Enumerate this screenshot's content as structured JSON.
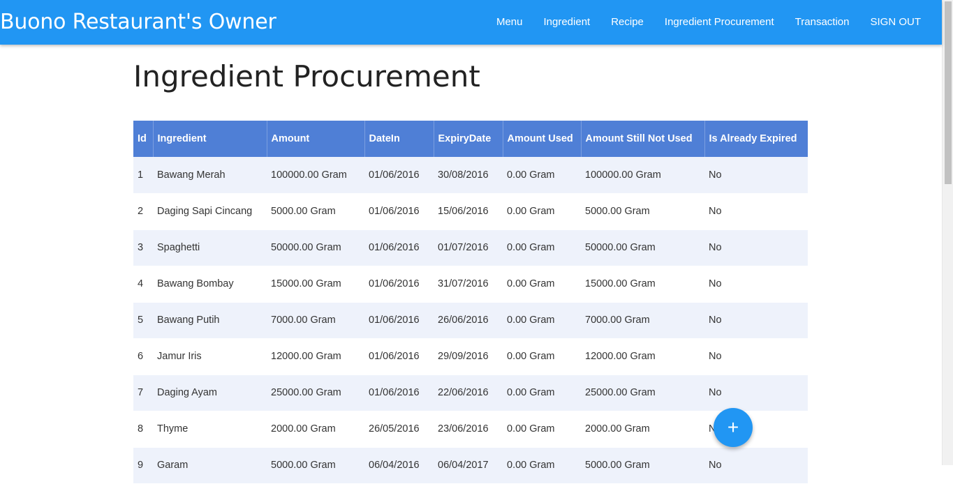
{
  "navbar": {
    "brand": "Buono Restaurant's Owner",
    "links": [
      "Menu",
      "Ingredient",
      "Recipe",
      "Ingredient Procurement",
      "Transaction",
      "SIGN OUT"
    ]
  },
  "page": {
    "title": "Ingredient Procurement"
  },
  "table": {
    "columns": [
      "Id",
      "Ingredient",
      "Amount",
      "DateIn",
      "ExpiryDate",
      "Amount Used",
      "Amount Still Not Used",
      "Is Already Expired"
    ],
    "rows": [
      [
        "1",
        "Bawang Merah",
        "100000.00 Gram",
        "01/06/2016",
        "30/08/2016",
        "0.00 Gram",
        "100000.00 Gram",
        "No"
      ],
      [
        "2",
        "Daging Sapi Cincang",
        "5000.00 Gram",
        "01/06/2016",
        "15/06/2016",
        "0.00 Gram",
        "5000.00 Gram",
        "No"
      ],
      [
        "3",
        "Spaghetti",
        "50000.00 Gram",
        "01/06/2016",
        "01/07/2016",
        "0.00 Gram",
        "50000.00 Gram",
        "No"
      ],
      [
        "4",
        "Bawang Bombay",
        "15000.00 Gram",
        "01/06/2016",
        "31/07/2016",
        "0.00 Gram",
        "15000.00 Gram",
        "No"
      ],
      [
        "5",
        "Bawang Putih",
        "7000.00 Gram",
        "01/06/2016",
        "26/06/2016",
        "0.00 Gram",
        "7000.00 Gram",
        "No"
      ],
      [
        "6",
        "Jamur Iris",
        "12000.00 Gram",
        "01/06/2016",
        "29/09/2016",
        "0.00 Gram",
        "12000.00 Gram",
        "No"
      ],
      [
        "7",
        "Daging Ayam",
        "25000.00 Gram",
        "01/06/2016",
        "22/06/2016",
        "0.00 Gram",
        "25000.00 Gram",
        "No"
      ],
      [
        "8",
        "Thyme",
        "2000.00 Gram",
        "26/05/2016",
        "23/06/2016",
        "0.00 Gram",
        "2000.00 Gram",
        "No"
      ],
      [
        "9",
        "Garam",
        "5000.00 Gram",
        "06/04/2016",
        "06/04/2017",
        "0.00 Gram",
        "5000.00 Gram",
        "No"
      ]
    ]
  },
  "fab": {
    "icon": "plus-icon",
    "glyph": "+"
  },
  "colors": {
    "navbar": "#2196f3",
    "table_header": "#4f7fd6",
    "row_stripe": "#eef2fb",
    "fab": "#2196f3"
  }
}
